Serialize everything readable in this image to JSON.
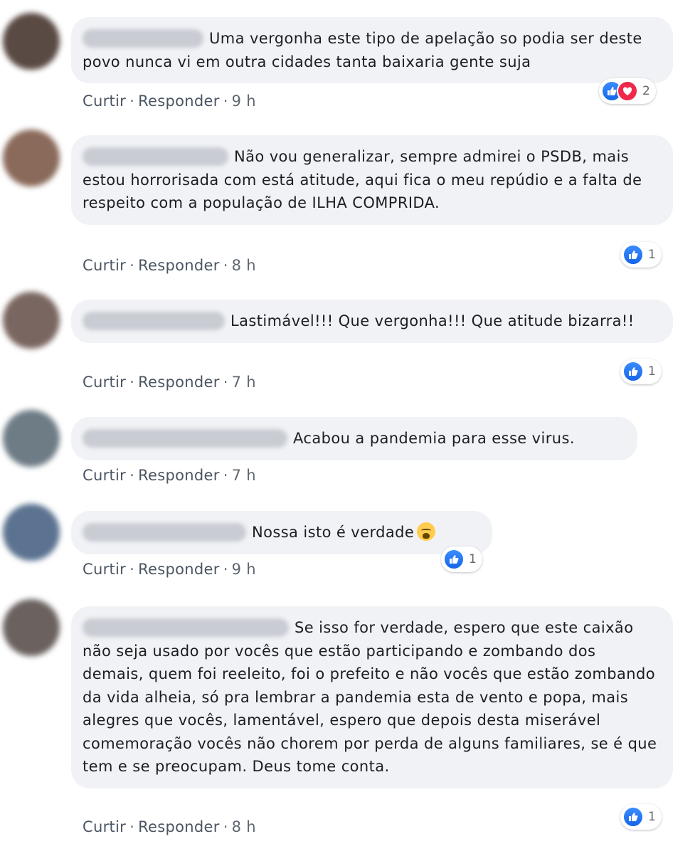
{
  "comments": [
    {
      "text": "Uma vergonha este tipo de apelação so podia ser deste povo nunca vi em outra cidades tanta baixaria gente suja",
      "actions": {
        "like": "Curtir",
        "reply": "Responder",
        "time": "9 h"
      },
      "reactions": {
        "types": [
          "like-icon",
          "love-icon"
        ],
        "count": "2"
      },
      "avatar_color": "#5a4a44"
    },
    {
      "text": "Não vou generalizar, sempre admirei o PSDB, mais estou horrorisada com está atitude, aqui fica o meu repúdio e a falta de respeito com a população de ILHA COMPRIDA.",
      "actions": {
        "like": "Curtir",
        "reply": "Responder",
        "time": "8 h"
      },
      "reactions": {
        "types": [
          "like-icon"
        ],
        "count": "1"
      },
      "avatar_color": "#8a6a5a"
    },
    {
      "text": "Lastimável!!! Que vergonha!!! Que atitude bizarra!!",
      "actions": {
        "like": "Curtir",
        "reply": "Responder",
        "time": "7 h"
      },
      "reactions": {
        "types": [
          "like-icon"
        ],
        "count": "1"
      },
      "avatar_color": "#7a6660"
    },
    {
      "text": "Acabou a pandemia para esse virus.",
      "actions": {
        "like": "Curtir",
        "reply": "Responder",
        "time": "7 h"
      },
      "reactions": null,
      "avatar_color": "#6e7c86"
    },
    {
      "text": "Nossa isto é verdade",
      "emoji": "crying-face-emoji",
      "actions": {
        "like": "Curtir",
        "reply": "Responder",
        "time": "9 h"
      },
      "reactions": {
        "types": [
          "like-icon"
        ],
        "count": "1"
      },
      "avatar_color": "#5b7390"
    },
    {
      "text": "Se isso for verdade, espero que este caixão não seja usado por vocês que estão participando e zombando dos demais, quem foi reeleito, foi o prefeito e não vocês que estão zombando da vida alheia, só pra lembrar a pandemia esta de vento e popa, mais alegres que vocês, lamentável, espero que depois desta miserável comemoração vocês não chorem por perda de alguns familiares, se é que tem e se preocupam. Deus tome conta.",
      "actions": {
        "like": "Curtir",
        "reply": "Responder",
        "time": "8 h"
      },
      "reactions": {
        "types": [
          "like-icon"
        ],
        "count": "1"
      },
      "avatar_color": "#6b6260"
    }
  ],
  "colors": {
    "bubble": "#f0f2f5",
    "like_blue": "#1877f2",
    "love_red": "#f0284a",
    "meta_text": "#606770"
  }
}
